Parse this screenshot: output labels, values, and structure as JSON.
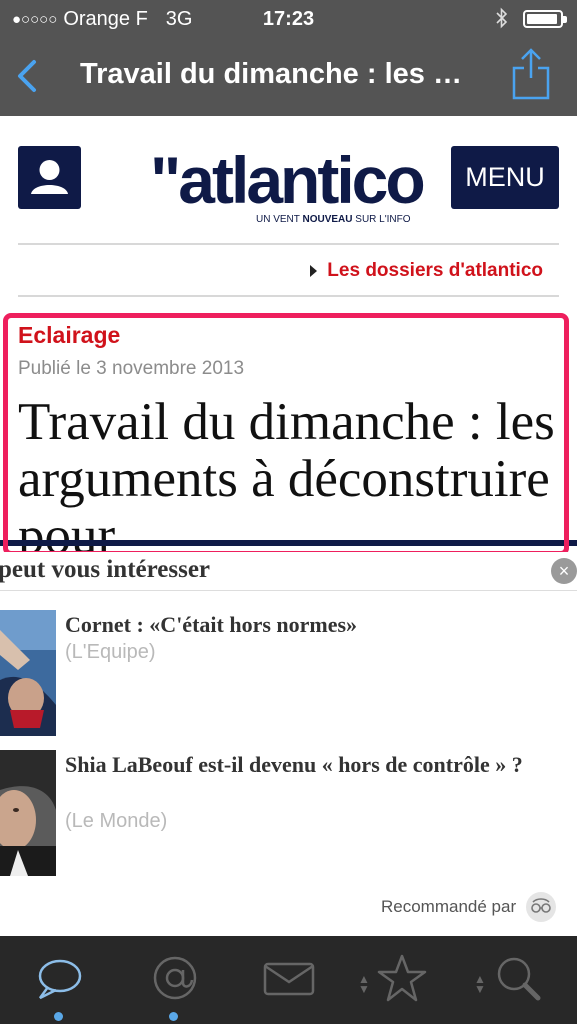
{
  "status_bar": {
    "signal": "●○○○○",
    "carrier": "Orange F",
    "network": "3G",
    "time": "17:23"
  },
  "nav": {
    "title": "Travail du dimanche : les arguments à déconstruire pour",
    "back_icon": "chevron-left-icon",
    "share_icon": "share-icon"
  },
  "site": {
    "logo_word": "\"atlantico",
    "tagline_pre": "UN VENT ",
    "tagline_bold": "NOUVEAU",
    "tagline_post": " SUR L'INFO",
    "menu_label": "MENU",
    "dossiers_link": "Les dossiers d'atlantico"
  },
  "article": {
    "section": "Eclairage",
    "date": "Publié le 3 novembre 2013",
    "headline": "Travail du dimanche : les arguments à déconstruire pour"
  },
  "recommendations": {
    "header": "peut vous intéresser",
    "close": "×",
    "items": [
      {
        "title": "Cornet : «C'était hors normes»",
        "source": "(L'Equipe)"
      },
      {
        "title": "Shia LaBeouf est-il devenu « hors de contrôle » ?",
        "source": "(Le Monde)"
      }
    ],
    "recommended_by": "Recommandé par"
  },
  "tabbar": {
    "tabs": [
      "chat-bubble-icon",
      "at-sign-icon",
      "mail-icon",
      "star-icon",
      "search-icon"
    ]
  },
  "colors": {
    "brand_navy": "#0f1a47",
    "brand_red": "#d0121b",
    "highlight": "#ee1f5d",
    "bar_grey": "#545454",
    "tab_dot": "#5aa8e8"
  }
}
